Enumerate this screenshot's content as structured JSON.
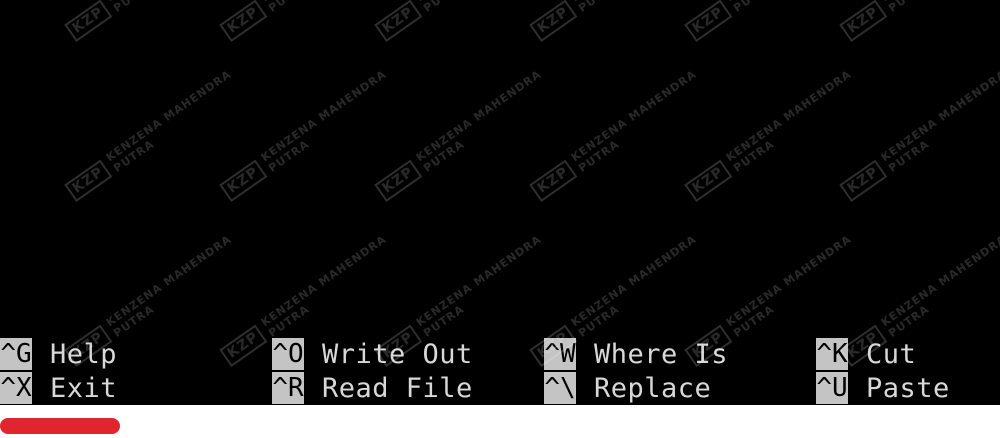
{
  "shortcuts": [
    [
      {
        "key": "^G",
        "label": "Help"
      },
      {
        "key": "^O",
        "label": "Write Out"
      },
      {
        "key": "^W",
        "label": "Where Is"
      },
      {
        "key": "^K",
        "label": "Cut"
      }
    ],
    [
      {
        "key": "^X",
        "label": "Exit"
      },
      {
        "key": "^R",
        "label": "Read File"
      },
      {
        "key": "^\\",
        "label": "Replace"
      },
      {
        "key": "^U",
        "label": "Paste"
      }
    ]
  ],
  "watermark": {
    "logo": "KZP",
    "line1": "KENZENA MAHENDRA",
    "line2": "PUTRA"
  },
  "progress": {
    "fraction": 0.12,
    "color": "#e0262c"
  },
  "colors": {
    "terminal_bg": "#000000",
    "text": "#d8d8d8",
    "key_bg": "#c4c4c4"
  }
}
